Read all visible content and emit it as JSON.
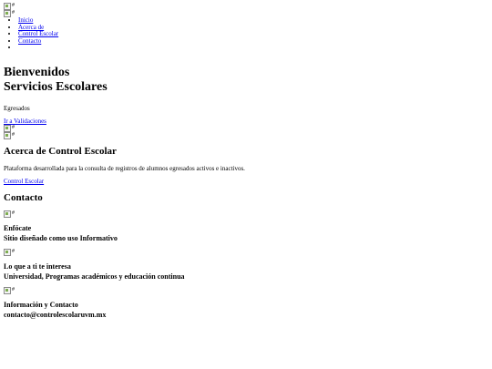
{
  "header": {
    "logo_alt": "#",
    "menu_icon_alt": "#"
  },
  "nav": {
    "items": [
      "Inicio",
      "Acerca de",
      "Control Escolar",
      "Contacto",
      ""
    ]
  },
  "hero": {
    "title_line1": "Bienvenidos",
    "title_line2": "Servicios Escolares",
    "subtitle": "Egresados",
    "cta_label": "Ir a Validaciones",
    "image1_alt": "#",
    "image2_alt": "#"
  },
  "about": {
    "title": "Acerca de Control Escolar",
    "description": "Plataforma desarrollada para la consulta de registros de alumnos egresados activos e inactivos.",
    "link_label": "Control Escolar"
  },
  "contact": {
    "title": "Contacto",
    "items": [
      {
        "icon_alt": "#",
        "title": "Enfócate",
        "text": "Sitio diseñado como uso Informativo"
      },
      {
        "icon_alt": "#",
        "title": "Lo que a ti te interesa",
        "text": "Universidad, Programas académicos y educación continua"
      },
      {
        "icon_alt": "#",
        "title": "Información y Contacto",
        "text": "contacto@controlescolaruvm.mx"
      }
    ]
  }
}
